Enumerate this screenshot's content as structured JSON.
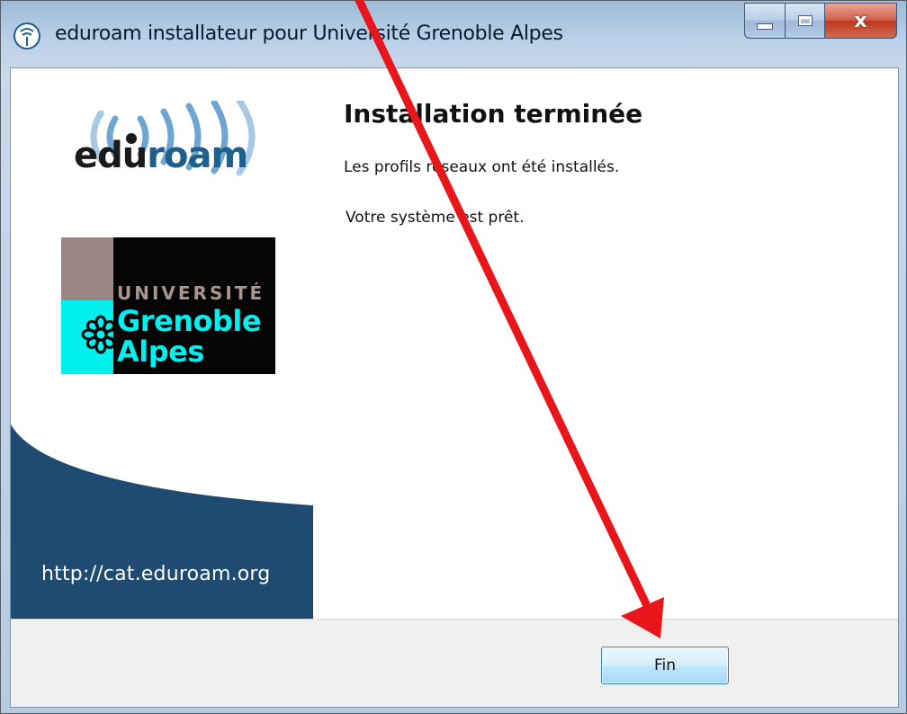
{
  "window": {
    "title": "eduroam installateur pour Université Grenoble Alpes",
    "controls": {
      "minimize": "minimize",
      "maximize": "maximize",
      "close": "x"
    }
  },
  "left_panel": {
    "eduroam_logo": {
      "edu": "edu",
      "roam": "roam"
    },
    "university_logo": {
      "line1": "UNIVERSITÉ",
      "line2": "Grenoble",
      "line3": "Alpes"
    },
    "url": "http://cat.eduroam.org"
  },
  "main": {
    "heading": "Installation terminée",
    "message1": "Les profils réseaux ont été installés.",
    "message2": "Votre système est prêt."
  },
  "footer": {
    "finish_label": "Fin"
  },
  "colors": {
    "eduroam_blue": "#1e5f8c",
    "panel_navy": "#1f4a72",
    "uga_cyan": "#00f0f0",
    "annotation_red": "#e8161b"
  }
}
